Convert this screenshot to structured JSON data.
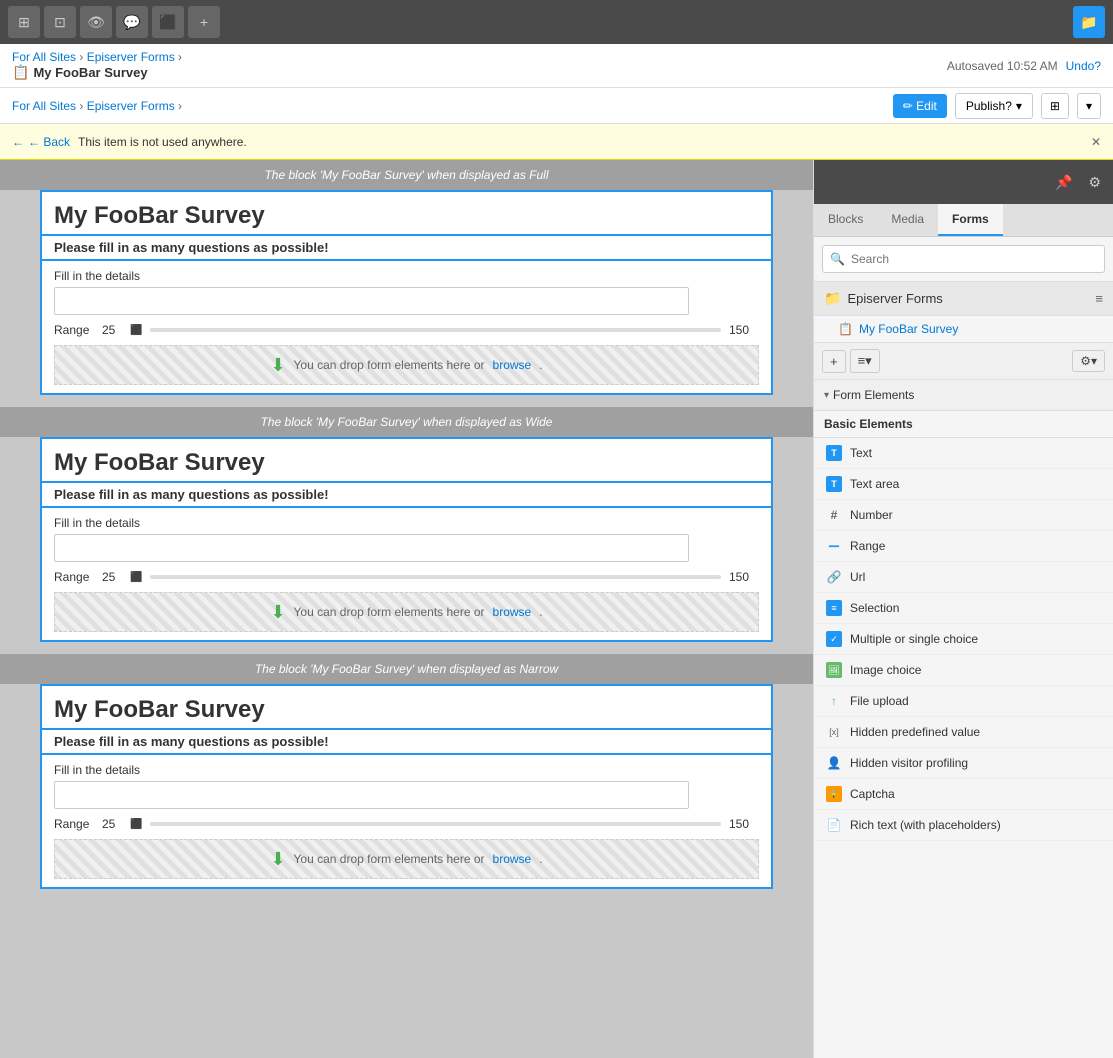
{
  "toolbar": {
    "buttons": [
      "⊞",
      "⊡",
      "👁",
      "💬",
      "⬛",
      "+"
    ]
  },
  "header": {
    "breadcrumb": "For All Sites › Episerver Forms ›",
    "page_title": "My FooBar Survey",
    "page_icon": "📋",
    "autosave": "Autosaved 10:52 AM",
    "undo": "Undo?"
  },
  "header2": {
    "breadcrumb_parts": [
      "For All Sites",
      "Episerver Forms"
    ],
    "edit_label": "✏ Edit",
    "publish_label": "Publish?",
    "view_label": "⊞"
  },
  "warning": {
    "back_label": "← Back",
    "message": "This item is not used anywhere.",
    "close": "✕"
  },
  "form_blocks": [
    {
      "label": "The block 'My FooBar Survey' when displayed as Full",
      "title": "My FooBar Survey",
      "subtitle": "Please fill in as many questions as possible!",
      "field_label": "Fill in the details",
      "range_label": "Range",
      "range_min": "25",
      "range_max": "150",
      "drop_text": "You can drop form elements here or",
      "browse_text": "browse"
    },
    {
      "label": "The block 'My FooBar Survey' when displayed as Wide",
      "title": "My FooBar Survey",
      "subtitle": "Please fill in as many questions as possible!",
      "field_label": "Fill in the details",
      "range_label": "Range",
      "range_min": "25",
      "range_max": "150",
      "drop_text": "You can drop form elements here or",
      "browse_text": "browse"
    },
    {
      "label": "The block 'My FooBar Survey' when displayed as Narrow",
      "title": "My FooBar Survey",
      "subtitle": "Please fill in as many questions as possible!",
      "field_label": "Fill in the details",
      "range_label": "Range",
      "range_min": "25",
      "range_max": "150",
      "drop_text": "You can drop form elements here or",
      "browse_text": "browse"
    }
  ],
  "right_panel": {
    "top_icons": [
      "📌",
      "⚙"
    ],
    "tabs": [
      "Blocks",
      "Media",
      "Forms"
    ],
    "active_tab": "Forms",
    "search_placeholder": "Search",
    "epi_forms_title": "Episerver Forms",
    "tree_item": "My FooBar Survey",
    "form_elements_label": "Form Elements",
    "basic_elements_label": "Basic Elements",
    "elements": [
      {
        "name": "Text",
        "icon_type": "text",
        "icon_char": "T"
      },
      {
        "name": "Text area",
        "icon_type": "text",
        "icon_char": "T"
      },
      {
        "name": "Number",
        "icon_type": "hash",
        "icon_char": "#"
      },
      {
        "name": "Range",
        "icon_type": "range",
        "icon_char": "━━"
      },
      {
        "name": "Url",
        "icon_type": "url",
        "icon_char": "🔗"
      },
      {
        "name": "Selection",
        "icon_type": "select",
        "icon_char": "≡"
      },
      {
        "name": "Multiple or single choice",
        "icon_type": "check",
        "icon_char": "✓"
      },
      {
        "name": "Image choice",
        "icon_type": "img",
        "icon_char": "🖼"
      },
      {
        "name": "File upload",
        "icon_type": "file",
        "icon_char": "↑"
      },
      {
        "name": "Hidden predefined value",
        "icon_type": "hidden",
        "icon_char": "[x]"
      },
      {
        "name": "Hidden visitor profiling",
        "icon_type": "visitor",
        "icon_char": "👤"
      },
      {
        "name": "Captcha",
        "icon_type": "captcha",
        "icon_char": "🔒"
      },
      {
        "name": "Rich text (with placeholders)",
        "icon_type": "rich",
        "icon_char": "📄"
      }
    ]
  },
  "colors": {
    "accent": "#2196f3",
    "warning_bg": "#fffde0",
    "toolbar_bg": "#4a4a4a"
  }
}
